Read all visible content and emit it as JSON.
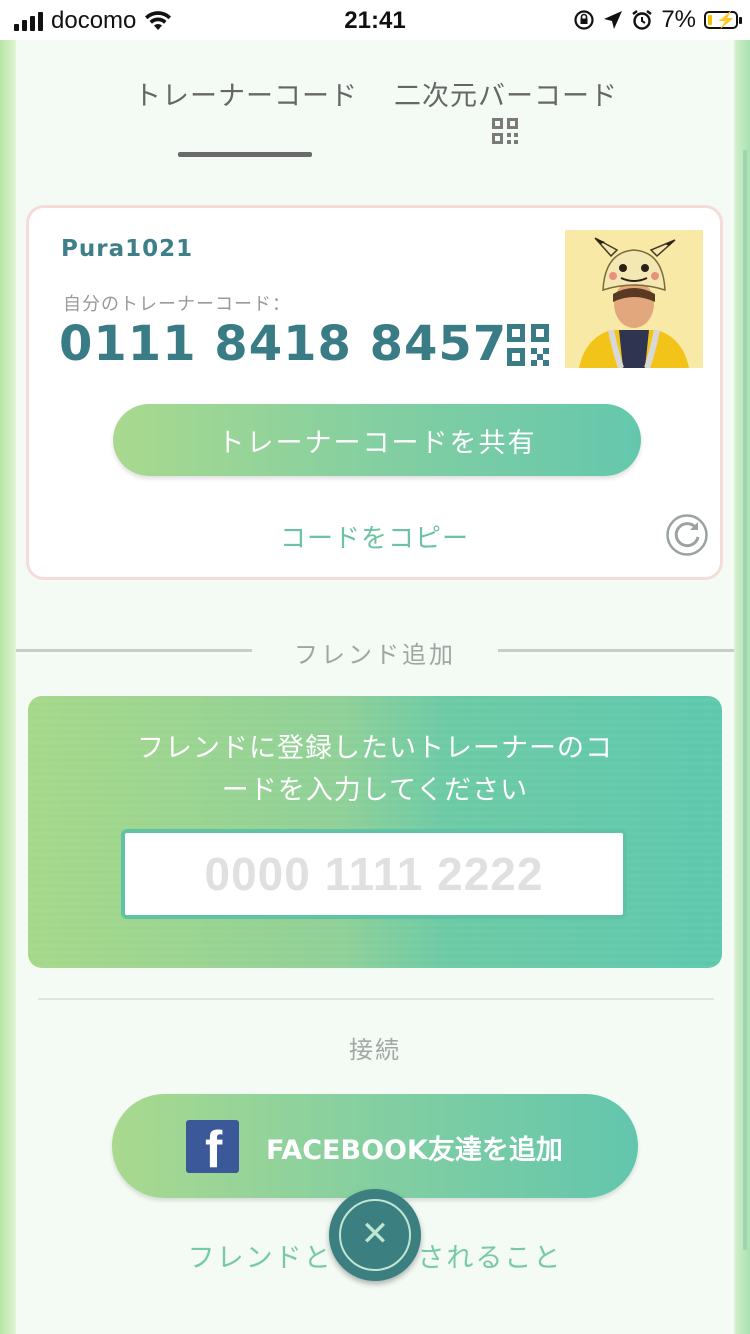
{
  "status_bar": {
    "carrier": "docomo",
    "time": "21:41",
    "battery_percent": "7%",
    "battery_level": 0.07
  },
  "tabs": {
    "trainer_code": "トレーナーコード",
    "qr_code": "二次元バーコード",
    "active": "trainer_code"
  },
  "card": {
    "username": "Pura1021",
    "code_label": "自分のトレーナーコード：",
    "code_value": "0111 8418 8457",
    "share_label": "トレーナーコードを共有",
    "copy_label": "コードをコピー"
  },
  "friend_add": {
    "title": "フレンド追加",
    "prompt": "フレンドに登録したいトレーナーのコードを入力してください",
    "input_value": "",
    "input_placeholder": "0000 1111 2222"
  },
  "connect": {
    "title": "接続",
    "facebook_label": "FACEBOOK友達を追加"
  },
  "bottom": {
    "link_label": "フレンドと        されること"
  },
  "colors": {
    "accent_teal": "#3a7c86",
    "accent_green": "#6cc3a2",
    "facebook_blue": "#3b5998"
  },
  "icons": [
    "wifi-icon",
    "qr-code-icon",
    "refresh-icon",
    "facebook-icon",
    "close-icon",
    "location-icon",
    "alarm-icon",
    "orientation-lock-icon",
    "battery-icon"
  ]
}
